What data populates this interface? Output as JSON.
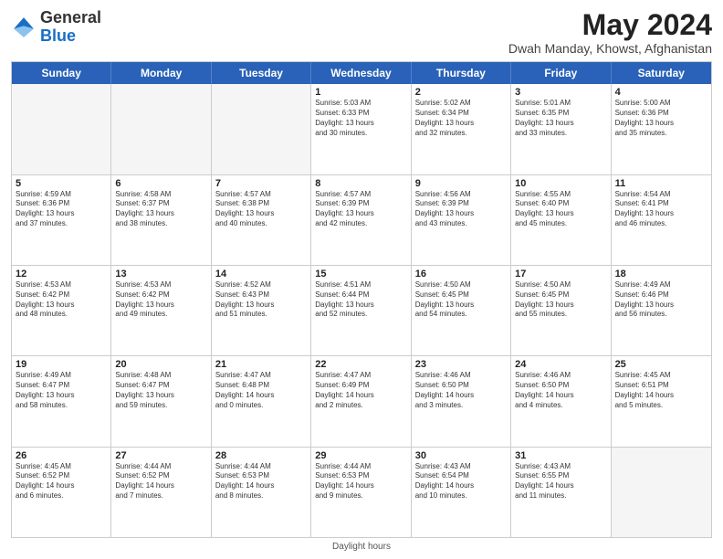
{
  "logo": {
    "general": "General",
    "blue": "Blue"
  },
  "title": {
    "month": "May 2024",
    "location": "Dwah Manday, Khowst, Afghanistan"
  },
  "weekdays": [
    "Sunday",
    "Monday",
    "Tuesday",
    "Wednesday",
    "Thursday",
    "Friday",
    "Saturday"
  ],
  "rows": [
    [
      {
        "day": "",
        "info": "",
        "empty": true
      },
      {
        "day": "",
        "info": "",
        "empty": true
      },
      {
        "day": "",
        "info": "",
        "empty": true
      },
      {
        "day": "1",
        "info": "Sunrise: 5:03 AM\nSunset: 6:33 PM\nDaylight: 13 hours\nand 30 minutes.",
        "empty": false
      },
      {
        "day": "2",
        "info": "Sunrise: 5:02 AM\nSunset: 6:34 PM\nDaylight: 13 hours\nand 32 minutes.",
        "empty": false
      },
      {
        "day": "3",
        "info": "Sunrise: 5:01 AM\nSunset: 6:35 PM\nDaylight: 13 hours\nand 33 minutes.",
        "empty": false
      },
      {
        "day": "4",
        "info": "Sunrise: 5:00 AM\nSunset: 6:36 PM\nDaylight: 13 hours\nand 35 minutes.",
        "empty": false
      }
    ],
    [
      {
        "day": "5",
        "info": "Sunrise: 4:59 AM\nSunset: 6:36 PM\nDaylight: 13 hours\nand 37 minutes.",
        "empty": false
      },
      {
        "day": "6",
        "info": "Sunrise: 4:58 AM\nSunset: 6:37 PM\nDaylight: 13 hours\nand 38 minutes.",
        "empty": false
      },
      {
        "day": "7",
        "info": "Sunrise: 4:57 AM\nSunset: 6:38 PM\nDaylight: 13 hours\nand 40 minutes.",
        "empty": false
      },
      {
        "day": "8",
        "info": "Sunrise: 4:57 AM\nSunset: 6:39 PM\nDaylight: 13 hours\nand 42 minutes.",
        "empty": false
      },
      {
        "day": "9",
        "info": "Sunrise: 4:56 AM\nSunset: 6:39 PM\nDaylight: 13 hours\nand 43 minutes.",
        "empty": false
      },
      {
        "day": "10",
        "info": "Sunrise: 4:55 AM\nSunset: 6:40 PM\nDaylight: 13 hours\nand 45 minutes.",
        "empty": false
      },
      {
        "day": "11",
        "info": "Sunrise: 4:54 AM\nSunset: 6:41 PM\nDaylight: 13 hours\nand 46 minutes.",
        "empty": false
      }
    ],
    [
      {
        "day": "12",
        "info": "Sunrise: 4:53 AM\nSunset: 6:42 PM\nDaylight: 13 hours\nand 48 minutes.",
        "empty": false
      },
      {
        "day": "13",
        "info": "Sunrise: 4:53 AM\nSunset: 6:42 PM\nDaylight: 13 hours\nand 49 minutes.",
        "empty": false
      },
      {
        "day": "14",
        "info": "Sunrise: 4:52 AM\nSunset: 6:43 PM\nDaylight: 13 hours\nand 51 minutes.",
        "empty": false
      },
      {
        "day": "15",
        "info": "Sunrise: 4:51 AM\nSunset: 6:44 PM\nDaylight: 13 hours\nand 52 minutes.",
        "empty": false
      },
      {
        "day": "16",
        "info": "Sunrise: 4:50 AM\nSunset: 6:45 PM\nDaylight: 13 hours\nand 54 minutes.",
        "empty": false
      },
      {
        "day": "17",
        "info": "Sunrise: 4:50 AM\nSunset: 6:45 PM\nDaylight: 13 hours\nand 55 minutes.",
        "empty": false
      },
      {
        "day": "18",
        "info": "Sunrise: 4:49 AM\nSunset: 6:46 PM\nDaylight: 13 hours\nand 56 minutes.",
        "empty": false
      }
    ],
    [
      {
        "day": "19",
        "info": "Sunrise: 4:49 AM\nSunset: 6:47 PM\nDaylight: 13 hours\nand 58 minutes.",
        "empty": false
      },
      {
        "day": "20",
        "info": "Sunrise: 4:48 AM\nSunset: 6:47 PM\nDaylight: 13 hours\nand 59 minutes.",
        "empty": false
      },
      {
        "day": "21",
        "info": "Sunrise: 4:47 AM\nSunset: 6:48 PM\nDaylight: 14 hours\nand 0 minutes.",
        "empty": false
      },
      {
        "day": "22",
        "info": "Sunrise: 4:47 AM\nSunset: 6:49 PM\nDaylight: 14 hours\nand 2 minutes.",
        "empty": false
      },
      {
        "day": "23",
        "info": "Sunrise: 4:46 AM\nSunset: 6:50 PM\nDaylight: 14 hours\nand 3 minutes.",
        "empty": false
      },
      {
        "day": "24",
        "info": "Sunrise: 4:46 AM\nSunset: 6:50 PM\nDaylight: 14 hours\nand 4 minutes.",
        "empty": false
      },
      {
        "day": "25",
        "info": "Sunrise: 4:45 AM\nSunset: 6:51 PM\nDaylight: 14 hours\nand 5 minutes.",
        "empty": false
      }
    ],
    [
      {
        "day": "26",
        "info": "Sunrise: 4:45 AM\nSunset: 6:52 PM\nDaylight: 14 hours\nand 6 minutes.",
        "empty": false
      },
      {
        "day": "27",
        "info": "Sunrise: 4:44 AM\nSunset: 6:52 PM\nDaylight: 14 hours\nand 7 minutes.",
        "empty": false
      },
      {
        "day": "28",
        "info": "Sunrise: 4:44 AM\nSunset: 6:53 PM\nDaylight: 14 hours\nand 8 minutes.",
        "empty": false
      },
      {
        "day": "29",
        "info": "Sunrise: 4:44 AM\nSunset: 6:53 PM\nDaylight: 14 hours\nand 9 minutes.",
        "empty": false
      },
      {
        "day": "30",
        "info": "Sunrise: 4:43 AM\nSunset: 6:54 PM\nDaylight: 14 hours\nand 10 minutes.",
        "empty": false
      },
      {
        "day": "31",
        "info": "Sunrise: 4:43 AM\nSunset: 6:55 PM\nDaylight: 14 hours\nand 11 minutes.",
        "empty": false
      },
      {
        "day": "",
        "info": "",
        "empty": true
      }
    ]
  ],
  "footer": {
    "daylight_label": "Daylight hours"
  }
}
